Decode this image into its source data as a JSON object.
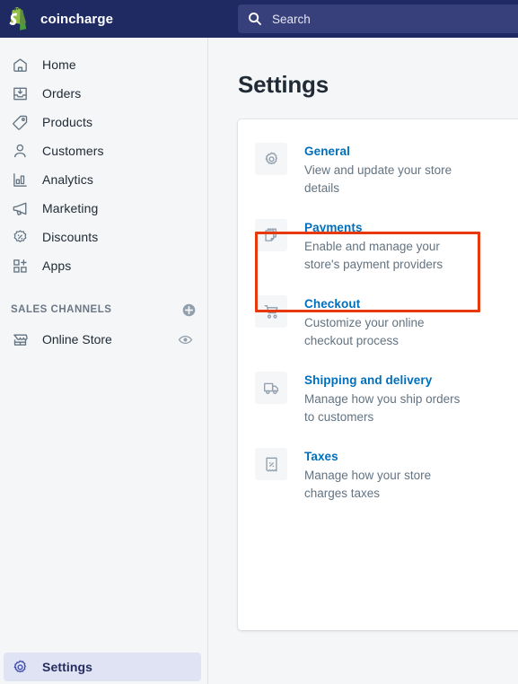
{
  "topbar": {
    "logo_icon": "shopify-bag-icon",
    "store_name": "coincharge",
    "search": {
      "icon": "search-icon",
      "placeholder": "Search",
      "value": ""
    }
  },
  "sidebar": {
    "items": [
      {
        "label": "Home",
        "icon": "home-icon"
      },
      {
        "label": "Orders",
        "icon": "orders-inbox-icon"
      },
      {
        "label": "Products",
        "icon": "product-tag-icon"
      },
      {
        "label": "Customers",
        "icon": "customer-person-icon"
      },
      {
        "label": "Analytics",
        "icon": "analytics-bar-chart-icon"
      },
      {
        "label": "Marketing",
        "icon": "marketing-megaphone-icon"
      },
      {
        "label": "Discounts",
        "icon": "discount-percent-icon"
      },
      {
        "label": "Apps",
        "icon": "apps-grid-plus-icon"
      }
    ],
    "sales_channels": {
      "title": "SALES CHANNELS",
      "add_icon": "circle-plus-icon",
      "channels": [
        {
          "label": "Online Store",
          "icon": "storefront-icon",
          "action_icon": "eye-icon"
        }
      ]
    },
    "settings": {
      "label": "Settings",
      "icon": "gear-icon",
      "active": true
    }
  },
  "main": {
    "page_title": "Settings",
    "settings_items": [
      {
        "title": "General",
        "description": "View and update your store details",
        "icon": "gear-icon"
      },
      {
        "title": "Payments",
        "description": "Enable and manage your store's payment providers",
        "icon": "payments-cards-icon",
        "highlighted": true
      },
      {
        "title": "Checkout",
        "description": "Customize your online checkout process",
        "icon": "shopping-cart-icon"
      },
      {
        "title": "Shipping and delivery",
        "description": "Manage how you ship orders to customers",
        "icon": "delivery-truck-icon"
      },
      {
        "title": "Taxes",
        "description": "Manage how your store charges taxes",
        "icon": "tax-receipt-percent-icon"
      }
    ]
  },
  "colors": {
    "topbar_bg": "#1f2a63",
    "search_bg": "#37407a",
    "page_bg": "#f4f6f8",
    "card_bg": "#ffffff",
    "link_blue": "#006fbb",
    "text_dark": "#212b36",
    "text_muted": "#637381",
    "highlight_red": "#e8380d",
    "active_nav_bg": "#dfe3f3",
    "shopify_green": "#5cb85c"
  }
}
